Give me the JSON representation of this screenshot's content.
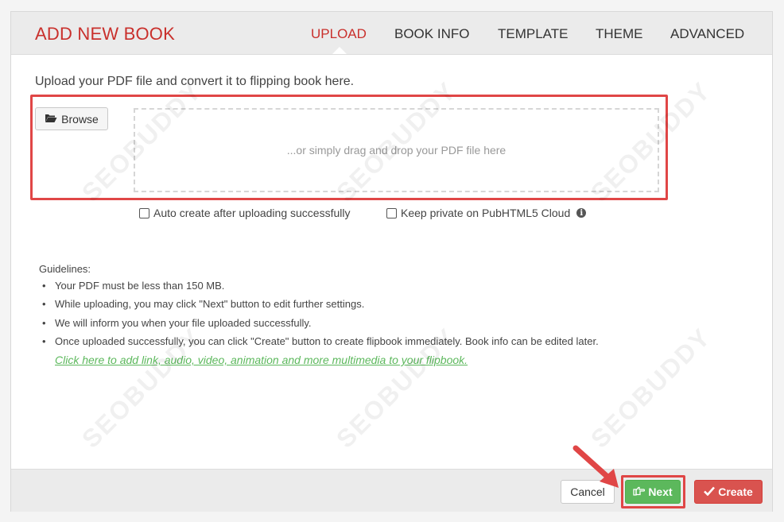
{
  "header": {
    "title": "ADD NEW BOOK",
    "tabs": [
      {
        "label": "UPLOAD",
        "active": true
      },
      {
        "label": "BOOK INFO",
        "active": false
      },
      {
        "label": "TEMPLATE",
        "active": false
      },
      {
        "label": "THEME",
        "active": false
      },
      {
        "label": "ADVANCED",
        "active": false
      }
    ]
  },
  "upload": {
    "intro": "Upload your PDF file and convert it to flipping book here.",
    "browse_label": "Browse",
    "dropzone_text": "...or simply drag and drop your PDF file here",
    "auto_create_label": "Auto create after uploading successfully",
    "keep_private_label": "Keep private on PubHTML5 Cloud"
  },
  "guidelines": {
    "title": "Guidelines:",
    "items": [
      "Your PDF must be less than 150 MB.",
      "While uploading, you may click \"Next\" button to edit further settings.",
      "We will inform you when your file uploaded successfully.",
      "Once uploaded successfully, you can click \"Create\" button to create flipbook immediately. Book info can be edited later."
    ],
    "link": "Click here to add link, audio, video, animation and more multimedia to your flipbook."
  },
  "footer": {
    "cancel_label": "Cancel",
    "next_label": "Next",
    "create_label": "Create"
  },
  "watermark": "SEOBUDDY",
  "colors": {
    "accent_red": "#c9302c",
    "highlight_red": "#e04646",
    "success_green": "#5cb85c",
    "danger_red": "#d9534f"
  }
}
